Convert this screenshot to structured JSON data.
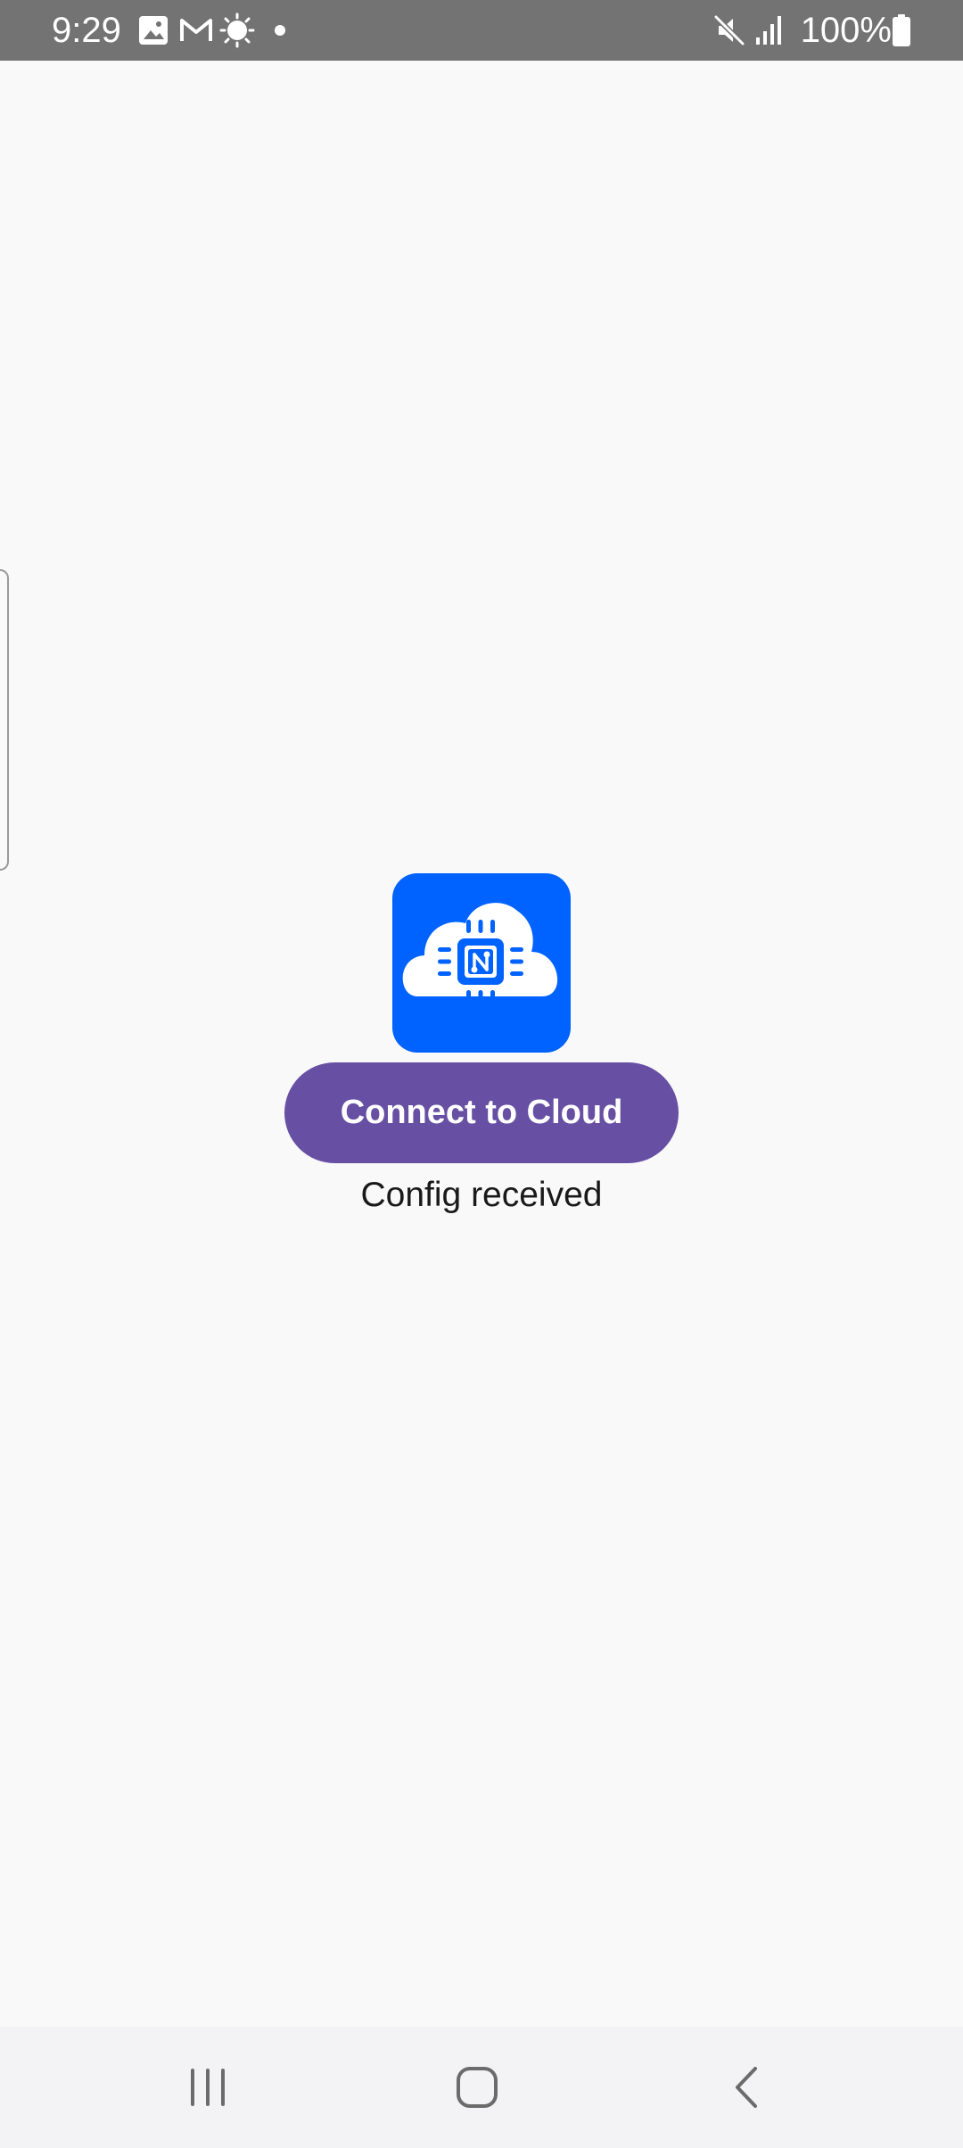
{
  "status_bar": {
    "time": "9:29",
    "battery": "100%",
    "icons": [
      "gallery-icon",
      "gmail-icon",
      "weather-icon",
      "notification-dot-icon",
      "mute-icon",
      "signal-icon",
      "battery-icon"
    ]
  },
  "main": {
    "logo_icon": "cloud-chip-logo-icon",
    "logo_letter": "N",
    "connect_button_label": "Connect to Cloud",
    "status_message": "Config received"
  },
  "nav_bar": {
    "items": [
      "recent-apps-icon",
      "home-icon",
      "back-icon"
    ]
  },
  "colors": {
    "status_bar": "#737373",
    "background": "#f9f9f9",
    "logo_bg": "#0062ff",
    "button_bg": "#6750a4",
    "button_text": "#ffffff"
  }
}
